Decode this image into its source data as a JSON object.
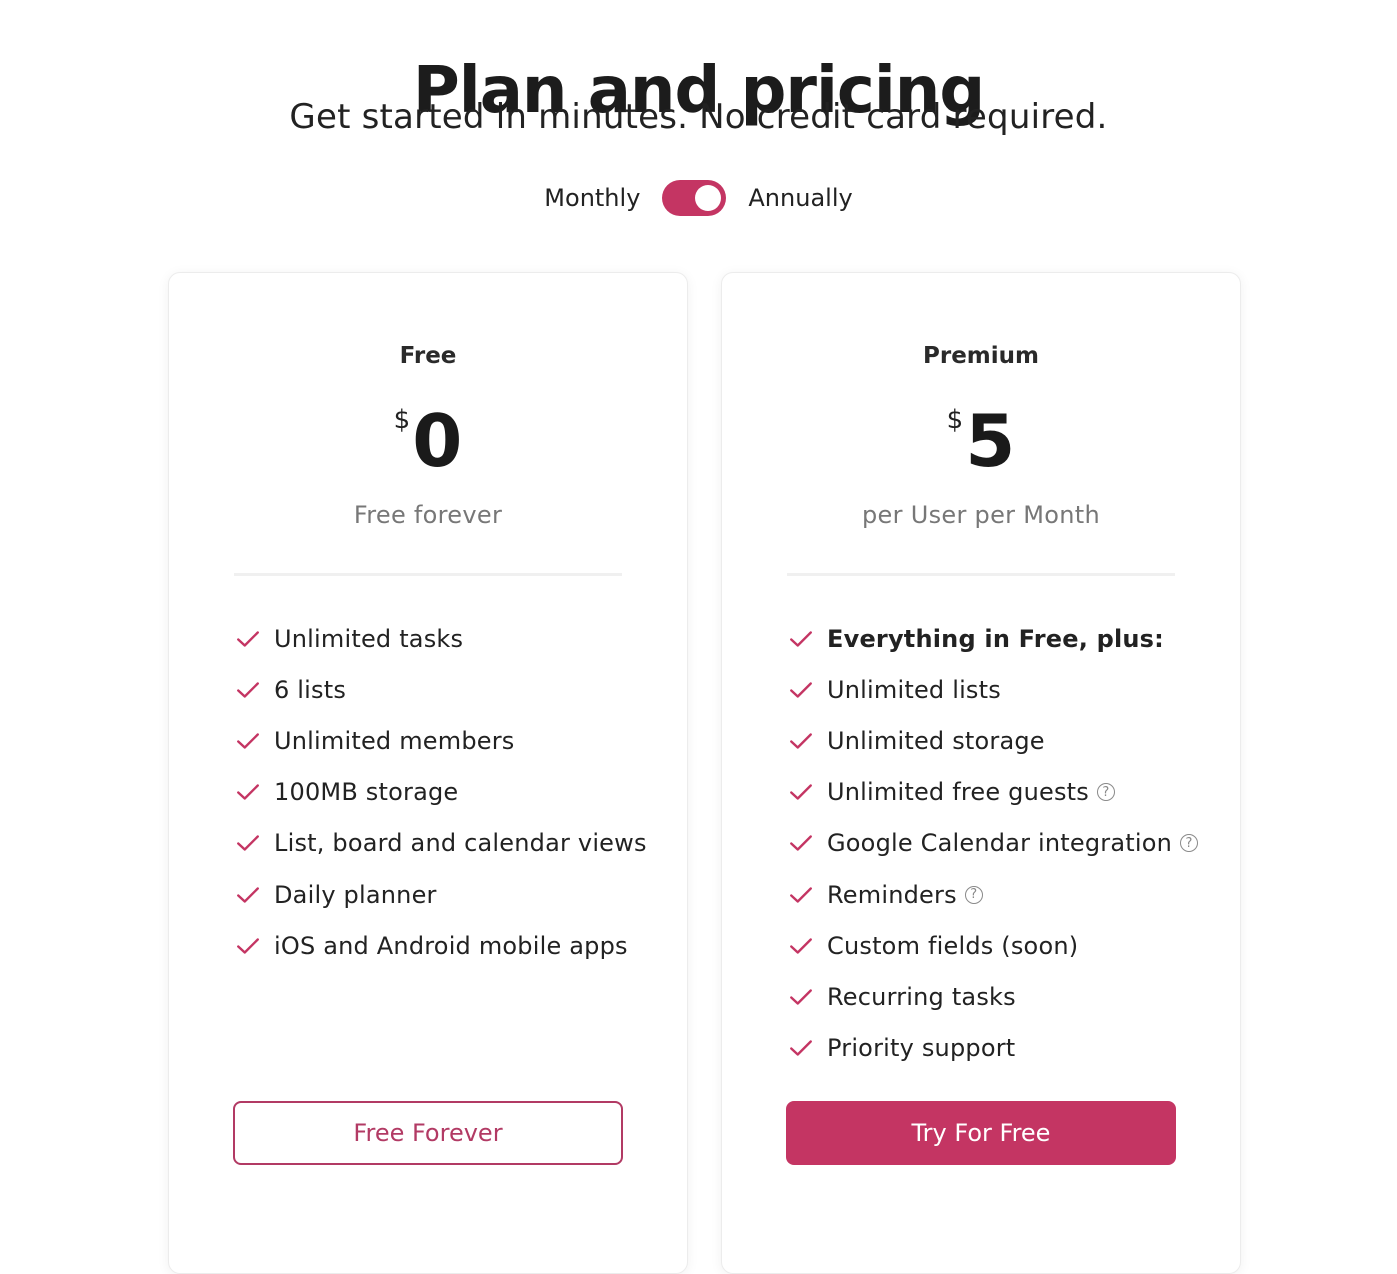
{
  "header": {
    "title": "Plan and pricing",
    "subtitle": "Get started in minutes. No credit card required."
  },
  "billing_toggle": {
    "left_label": "Monthly",
    "right_label": "Annually",
    "selected": "Annually",
    "accent_color": "#c43563"
  },
  "plans": [
    {
      "name": "Free",
      "currency": "$",
      "price": "0",
      "period": "Free forever",
      "features": [
        {
          "text": "Unlimited tasks",
          "help": false,
          "bold": false
        },
        {
          "text": "6 lists",
          "help": false,
          "bold": false
        },
        {
          "text": "Unlimited members",
          "help": false,
          "bold": false
        },
        {
          "text": "100MB storage",
          "help": false,
          "bold": false
        },
        {
          "text": "List, board and calendar views",
          "help": false,
          "bold": false
        },
        {
          "text": "Daily planner",
          "help": false,
          "bold": false
        },
        {
          "text": "iOS and Android mobile apps",
          "help": false,
          "bold": false
        }
      ],
      "button_label": "Free Forever",
      "button_style": "outline"
    },
    {
      "name": "Premium",
      "currency": "$",
      "price": "5",
      "period": "per User per Month",
      "features": [
        {
          "text": "Everything in Free, plus:",
          "help": false,
          "bold": true
        },
        {
          "text": "Unlimited lists",
          "help": false,
          "bold": false
        },
        {
          "text": "Unlimited storage",
          "help": false,
          "bold": false
        },
        {
          "text": "Unlimited free guests",
          "help": true,
          "bold": false
        },
        {
          "text": "Google Calendar integration",
          "help": true,
          "bold": false
        },
        {
          "text": "Reminders",
          "help": true,
          "bold": false
        },
        {
          "text": "Custom fields (soon)",
          "help": false,
          "bold": false
        },
        {
          "text": "Recurring tasks",
          "help": false,
          "bold": false
        },
        {
          "text": "Priority support",
          "help": false,
          "bold": false
        }
      ],
      "button_label": "Try For Free",
      "button_style": "filled"
    }
  ],
  "icons": {
    "check": "check-icon",
    "help": "help-circle-icon",
    "help_glyph": "?"
  }
}
